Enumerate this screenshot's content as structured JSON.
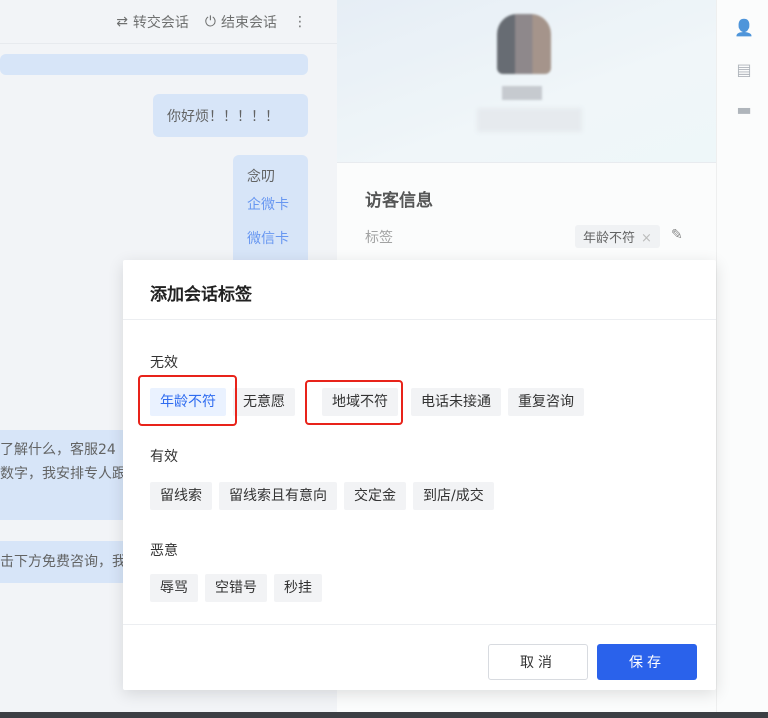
{
  "chat": {
    "header": {
      "transfer_label": "转交会话",
      "end_label": "结束会话"
    },
    "messages": [
      {
        "text": "你好烦！！！！！"
      },
      {
        "lines": [
          "念叨",
          "企微卡",
          "微信卡"
        ]
      },
      {
        "lines": [
          "了解什么，客服24",
          "数字，我安排专人跟"
        ]
      },
      {
        "text": "击下方免费咨询，我"
      }
    ]
  },
  "visitor": {
    "section_title": "访客信息",
    "tag_label": "标签",
    "tag_value": "年龄不符",
    "tag_remove": "×"
  },
  "dialog": {
    "title": "添加会话标签",
    "groups": [
      {
        "label": "无效",
        "tags": [
          "年龄不符",
          "无意愿",
          "地域不符",
          "电话未接通",
          "重复咨询"
        ]
      },
      {
        "label": "有效",
        "tags": [
          "留线索",
          "留线索且有意向",
          "交定金",
          "到店/成交"
        ]
      },
      {
        "label": "恶意",
        "tags": [
          "辱骂",
          "空错号",
          "秒挂"
        ]
      }
    ],
    "selected_tag": "年龄不符",
    "cancel_label": "取消",
    "save_label": "保存"
  },
  "colors": {
    "accent": "#2a62eb",
    "highlight": "#e8231a",
    "bubble": "#cfe0fa"
  }
}
